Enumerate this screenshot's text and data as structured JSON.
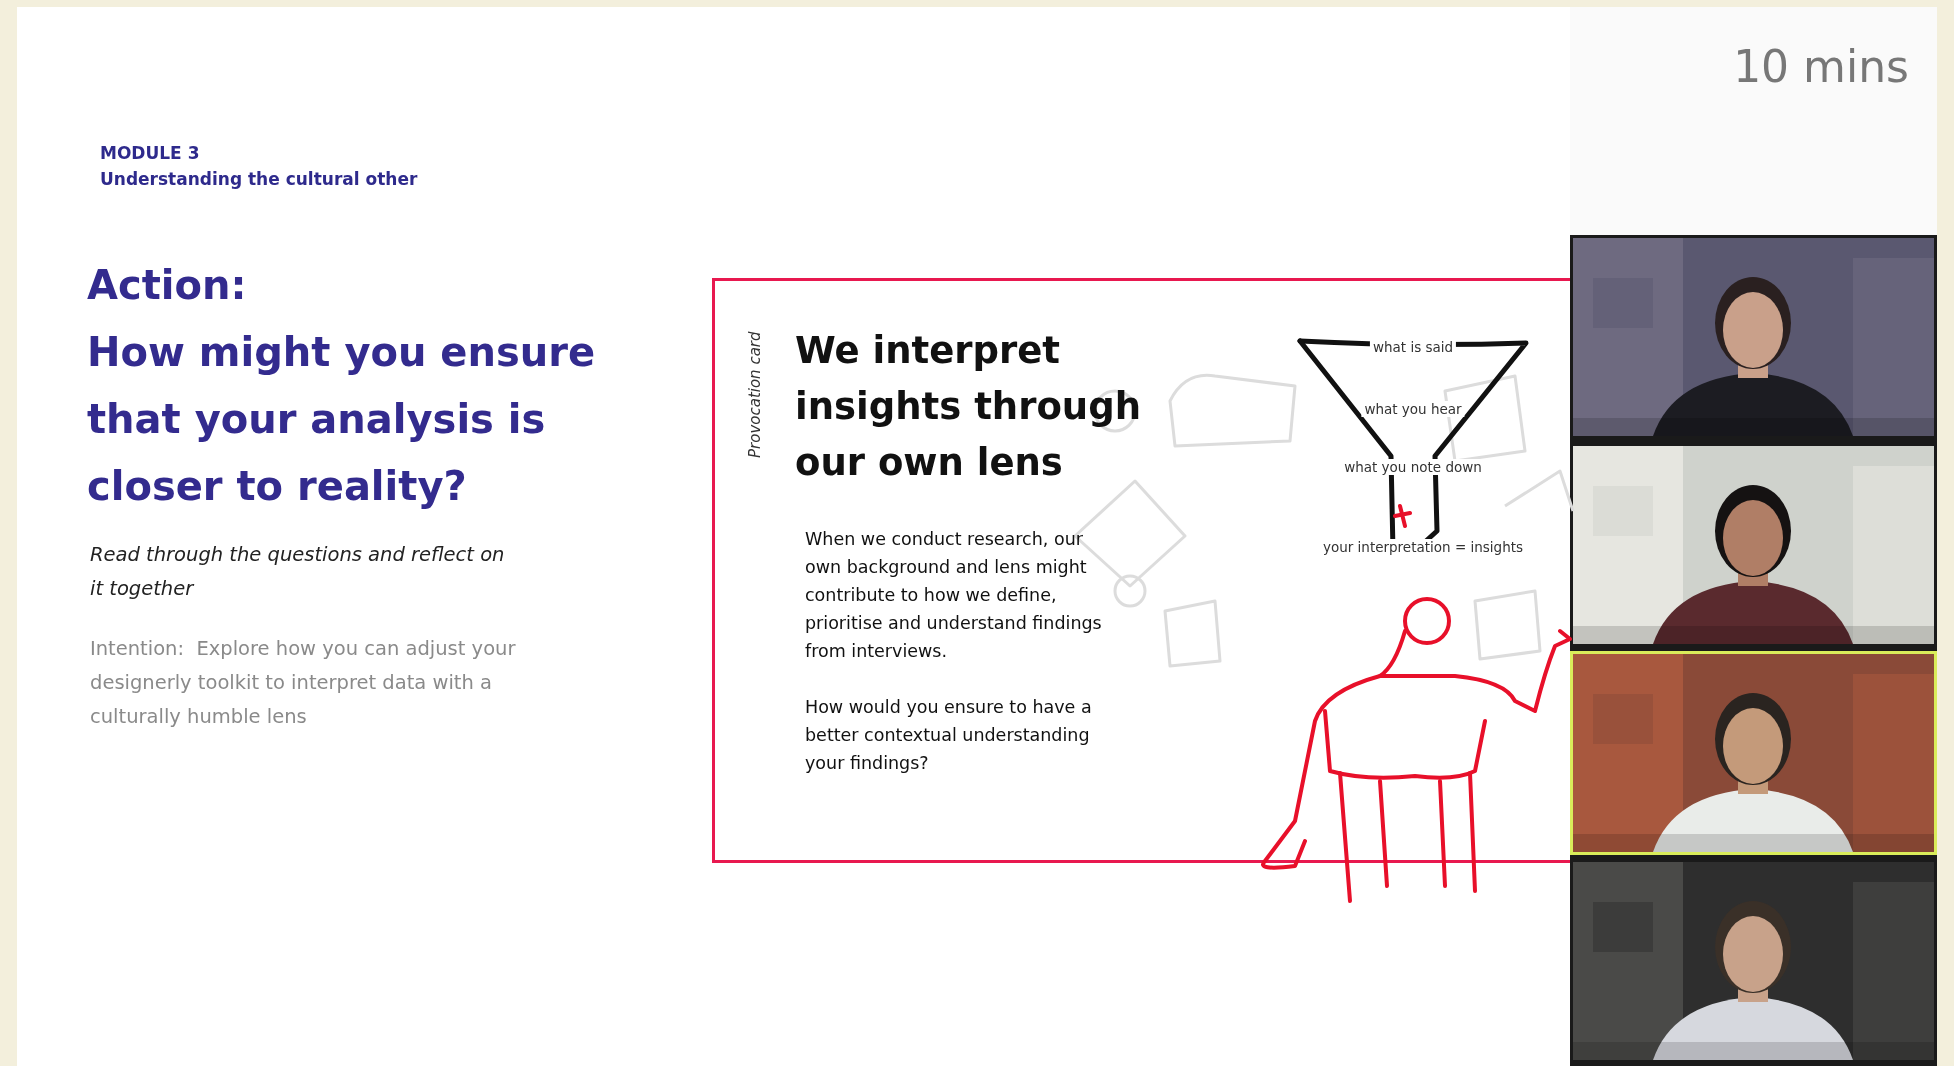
{
  "slide": {
    "module": "MODULE 3",
    "module_title": "Understanding the cultural other",
    "heading": "Action:",
    "question": "How might you ensure that your analysis is closer to reality?",
    "instruction": "Read through the questions and reflect on it together",
    "intention": "Intention:  Explore how you can adjust your designerly toolkit to interpret data with a culturally humble lens"
  },
  "card": {
    "label": "Provocation card",
    "title": "We interpret insights through our own lens",
    "paragraphs": [
      "When we conduct research, our own background and lens might contribute to how we define, prioritise and understand findings from interviews.",
      "How would you ensure to have a better contextual understanding your findings?"
    ],
    "funnel_labels": [
      "what is said",
      "what you hear",
      "what you note down",
      "your interpretation = insights"
    ]
  },
  "timer": "10 mins",
  "videos": [
    {
      "speaking": false
    },
    {
      "speaking": false
    },
    {
      "speaking": true
    },
    {
      "speaking": false
    }
  ]
}
